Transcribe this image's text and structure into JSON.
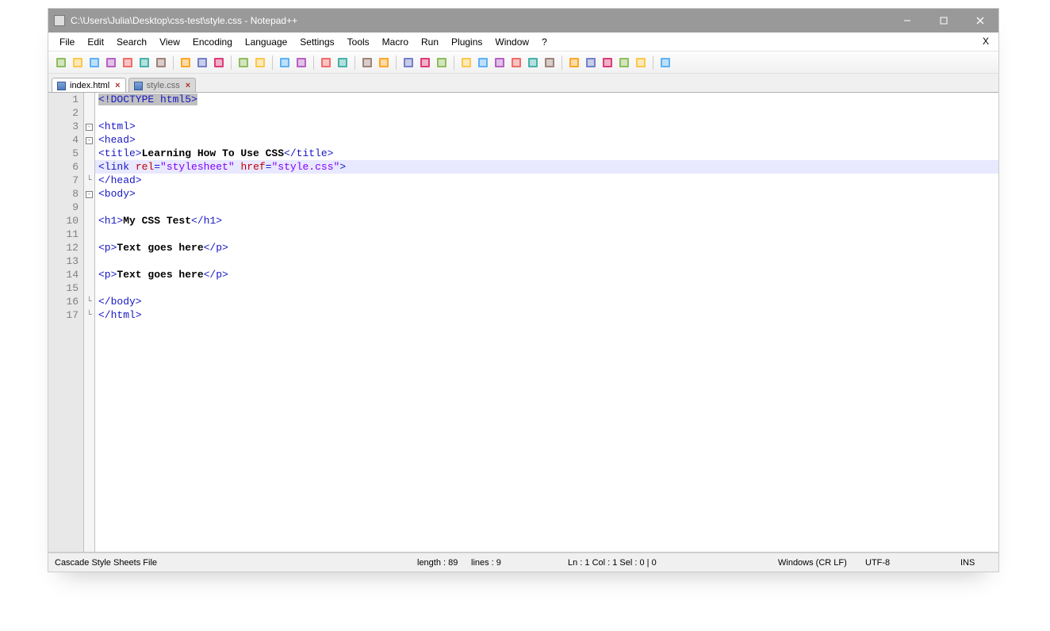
{
  "title": "C:\\Users\\Julia\\Desktop\\css-test\\style.css - Notepad++",
  "menubar": [
    "File",
    "Edit",
    "Search",
    "View",
    "Encoding",
    "Language",
    "Settings",
    "Tools",
    "Macro",
    "Run",
    "Plugins",
    "Window",
    "?"
  ],
  "menubar_close": "X",
  "toolbar_icons": [
    "new-file-icon",
    "open-file-icon",
    "save-icon",
    "save-all-icon",
    "close-icon",
    "close-all-icon",
    "print-icon",
    "|",
    "cut-icon",
    "copy-icon",
    "paste-icon",
    "|",
    "undo-icon",
    "redo-icon",
    "|",
    "find-icon",
    "replace-icon",
    "|",
    "zoom-in-icon",
    "zoom-out-icon",
    "|",
    "sync-v-icon",
    "sync-h-icon",
    "|",
    "wordwrap-icon",
    "all-chars-icon",
    "indent-guide-icon",
    "|",
    "lang-icon",
    "doc-map-icon",
    "doc-list-icon",
    "func-list-icon",
    "folder-icon",
    "monitor-icon",
    "|",
    "record-icon",
    "stop-icon",
    "play-icon",
    "play-multi-icon",
    "save-macro-icon",
    "|",
    "spellcheck-icon"
  ],
  "tabs": [
    {
      "name": "index.html",
      "active": true
    },
    {
      "name": "style.css",
      "active": false
    }
  ],
  "gutter_lines": [
    "1",
    "2",
    "3",
    "4",
    "5",
    "6",
    "7",
    "8",
    "9",
    "10",
    "11",
    "12",
    "13",
    "14",
    "15",
    "16",
    "17"
  ],
  "fold_marks": {
    "1": "",
    "3": "box",
    "4": "box-minus",
    "5": "",
    "6": "",
    "7": "line",
    "8": "box",
    "9": "",
    "10": "",
    "11": "",
    "12": "",
    "13": "",
    "14": "",
    "15": "",
    "16": "line",
    "17": "line"
  },
  "code_lines": [
    {
      "selected": true,
      "tokens": [
        {
          "t": "<!DOCTYPE html5>",
          "c": "tag"
        }
      ]
    },
    {
      "tokens": []
    },
    {
      "tokens": [
        {
          "t": "<html>",
          "c": "tag"
        }
      ]
    },
    {
      "tokens": [
        {
          "t": "<head>",
          "c": "tag"
        }
      ]
    },
    {
      "tokens": [
        {
          "t": "<title>",
          "c": "tag"
        },
        {
          "t": "Learning How To Use CSS",
          "c": "txt"
        },
        {
          "t": "</title>",
          "c": "tag"
        }
      ]
    },
    {
      "highlight": true,
      "tokens": [
        {
          "t": "<link ",
          "c": "tag"
        },
        {
          "t": "rel",
          "c": "attr"
        },
        {
          "t": "=",
          "c": "tag"
        },
        {
          "t": "\"stylesheet\"",
          "c": "str"
        },
        {
          "t": " ",
          "c": "tag"
        },
        {
          "t": "href",
          "c": "attr"
        },
        {
          "t": "=",
          "c": "tag"
        },
        {
          "t": "\"style.css\"",
          "c": "str"
        },
        {
          "t": ">",
          "c": "tag"
        }
      ]
    },
    {
      "tokens": [
        {
          "t": "</head>",
          "c": "tag"
        }
      ]
    },
    {
      "tokens": [
        {
          "t": "<body>",
          "c": "tag"
        }
      ]
    },
    {
      "tokens": []
    },
    {
      "tokens": [
        {
          "t": "<h1>",
          "c": "tag"
        },
        {
          "t": "My CSS Test",
          "c": "txt"
        },
        {
          "t": "</h1>",
          "c": "tag"
        }
      ]
    },
    {
      "tokens": []
    },
    {
      "tokens": [
        {
          "t": "<p>",
          "c": "tag"
        },
        {
          "t": "Text goes here",
          "c": "txt"
        },
        {
          "t": "</p>",
          "c": "tag"
        }
      ]
    },
    {
      "tokens": []
    },
    {
      "tokens": [
        {
          "t": "<p>",
          "c": "tag"
        },
        {
          "t": "Text goes here",
          "c": "txt"
        },
        {
          "t": "</p>",
          "c": "tag"
        }
      ]
    },
    {
      "tokens": []
    },
    {
      "tokens": [
        {
          "t": "</body>",
          "c": "tag"
        }
      ]
    },
    {
      "tokens": [
        {
          "t": "</html>",
          "c": "tag"
        }
      ]
    }
  ],
  "status": {
    "filetype": "Cascade Style Sheets File",
    "length": "length : 89",
    "lines": "lines : 9",
    "pos": "Ln : 1   Col : 1   Sel : 0 | 0",
    "eol": "Windows (CR LF)",
    "encoding": "UTF-8",
    "mode": "INS"
  }
}
